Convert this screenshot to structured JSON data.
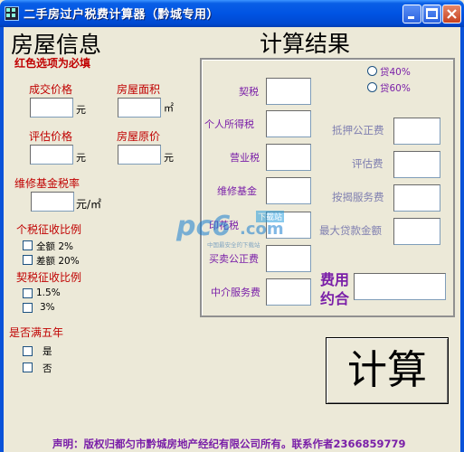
{
  "window": {
    "title": "二手房过户税费计算器（黔城专用）"
  },
  "left": {
    "heading": "房屋信息",
    "required_note": "红色选项为必填",
    "deal_price_label": "成交价格",
    "deal_price_unit": "元",
    "area_label": "房屋面积",
    "area_unit": "㎡",
    "appraisal_label": "评估价格",
    "appraisal_unit": "元",
    "original_label": "房屋原价",
    "original_unit": "元",
    "maint_rate_label": "维修基金税率",
    "maint_rate_unit": "元/㎡",
    "income_tax_ratio_label": "个税征收比例",
    "income_opt_full": "全额  2%",
    "income_opt_diff": "差额  20%",
    "deed_tax_ratio_label": "契税征收比例",
    "deed_opt_15": "1.5%",
    "deed_opt_3": "3%",
    "five_years_label": "是否满五年",
    "five_yes": "是",
    "five_no": "否"
  },
  "right": {
    "heading": "计算结果",
    "loan_40": "贷40%",
    "loan_60": "贷60%",
    "deed_tax_label": "契税",
    "income_tax_label": "个人所得税",
    "business_tax_label": "营业税",
    "maint_fund_label": "维修基金",
    "stamp_tax_label": "印花税",
    "trade_notary_label": "买卖公正费",
    "agent_fee_label": "中介服务费",
    "mortgage_notary_label": "抵押公正费",
    "appraisal_fee_label": "评估费",
    "mortgage_service_label": "按揭服务费",
    "max_loan_label": "最大贷款金额",
    "fee_agreement_label_1": "费用",
    "fee_agreement_label_2": "约合"
  },
  "calc_button": "计算",
  "footer": "声明：版权归都匀市黔城房地产经纪有限公司所有。联系作者2366859779",
  "watermark": {
    "brand": "pc6",
    "suffix": ".com",
    "tag": "下载站",
    "slogan": "中国最安全的下载站"
  },
  "colors": {
    "required_red": "#C00000",
    "result_purple": "#7A1FA8",
    "secondary_gray": "#7F7FB0",
    "face": "#ECE9D8"
  }
}
